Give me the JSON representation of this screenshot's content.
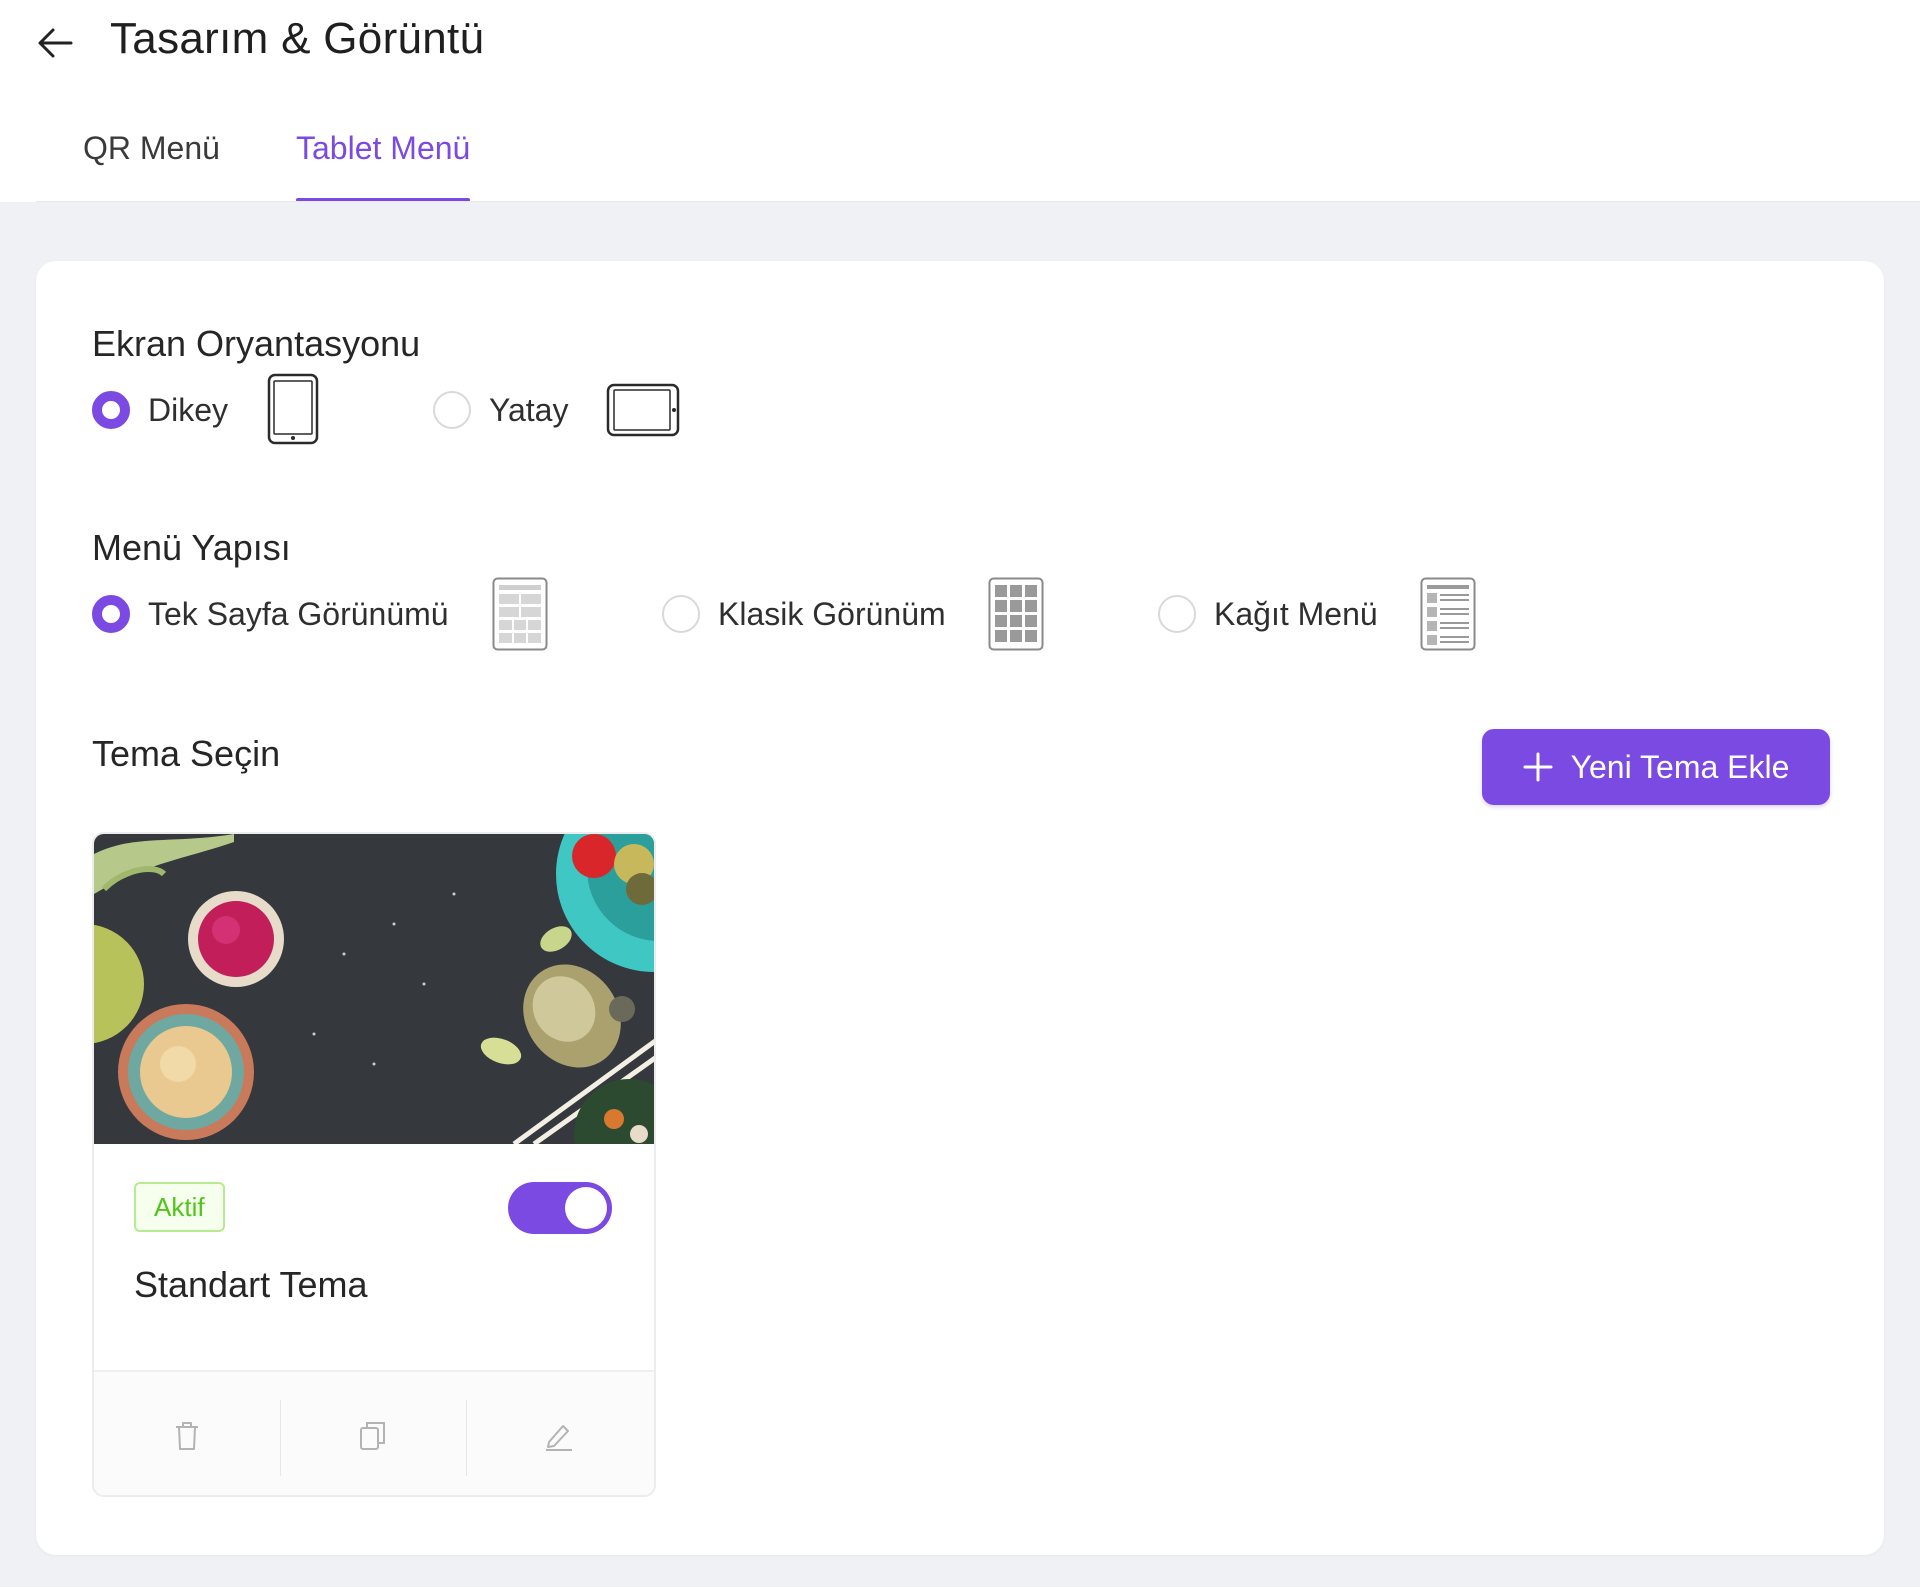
{
  "header": {
    "title": "Tasarım & Görüntü",
    "back_icon": "arrow-left-icon"
  },
  "tabs": [
    {
      "label": "QR Menü",
      "active": false
    },
    {
      "label": "Tablet Menü",
      "active": true
    }
  ],
  "orientation": {
    "title": "Ekran Oryantasyonu",
    "options": [
      {
        "label": "Dikey",
        "checked": true,
        "icon": "tablet-portrait-icon"
      },
      {
        "label": "Yatay",
        "checked": false,
        "icon": "tablet-landscape-icon"
      }
    ]
  },
  "menu_structure": {
    "title": "Menü Yapısı",
    "options": [
      {
        "label": "Tek Sayfa Görünümü",
        "checked": true,
        "icon": "single-page-layout-icon"
      },
      {
        "label": "Klasik Görünüm",
        "checked": false,
        "icon": "classic-grid-layout-icon"
      },
      {
        "label": "Kağıt Menü",
        "checked": false,
        "icon": "paper-menu-layout-icon"
      }
    ]
  },
  "themes": {
    "title": "Tema Seçin",
    "add_button_label": "Yeni Tema Ekle",
    "add_button_icon": "plus-icon",
    "items": [
      {
        "name": "Standart Tema",
        "status": "Aktif",
        "enabled": true,
        "image": "food-table-photo",
        "actions": [
          "trash-icon",
          "copy-icon",
          "edit-icon"
        ]
      }
    ]
  },
  "colors": {
    "accent": "#7b4ae2",
    "success": "#52c41a",
    "background": "#f0f1f4"
  }
}
